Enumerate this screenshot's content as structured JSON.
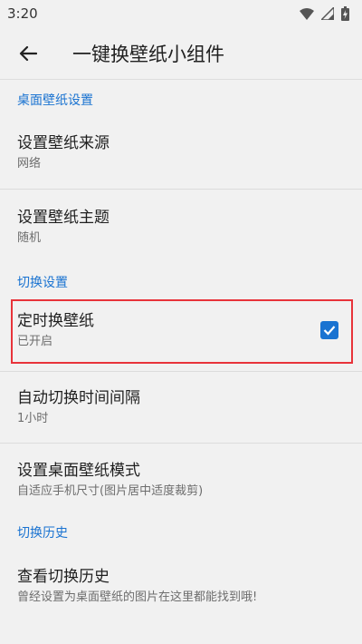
{
  "status_bar": {
    "time": "3:20"
  },
  "app_bar": {
    "title": "一键换壁纸小组件"
  },
  "sections": {
    "desktop": {
      "header": "桌面壁纸设置",
      "source": {
        "title": "设置壁纸来源",
        "summary": "网络"
      },
      "theme": {
        "title": "设置壁纸主题",
        "summary": "随机"
      }
    },
    "switch": {
      "header": "切换设置",
      "timed": {
        "title": "定时换壁纸",
        "summary": "已开启",
        "checked": true
      },
      "interval": {
        "title": "自动切换时间间隔",
        "summary": "1小时"
      },
      "mode": {
        "title": "设置桌面壁纸模式",
        "summary": "自适应手机尺寸(图片居中适度裁剪)"
      }
    },
    "history": {
      "header": "切换历史",
      "view": {
        "title": "查看切换历史",
        "summary": "曾经设置为桌面壁纸的图片在这里都能找到哦!"
      }
    }
  },
  "colors": {
    "accent": "#1a73d1",
    "highlight": "#e8333a",
    "background": "#f1f1f1"
  },
  "icons": [
    "wifi-icon",
    "signal-icon",
    "battery-icon",
    "back-arrow-icon",
    "check-icon"
  ]
}
